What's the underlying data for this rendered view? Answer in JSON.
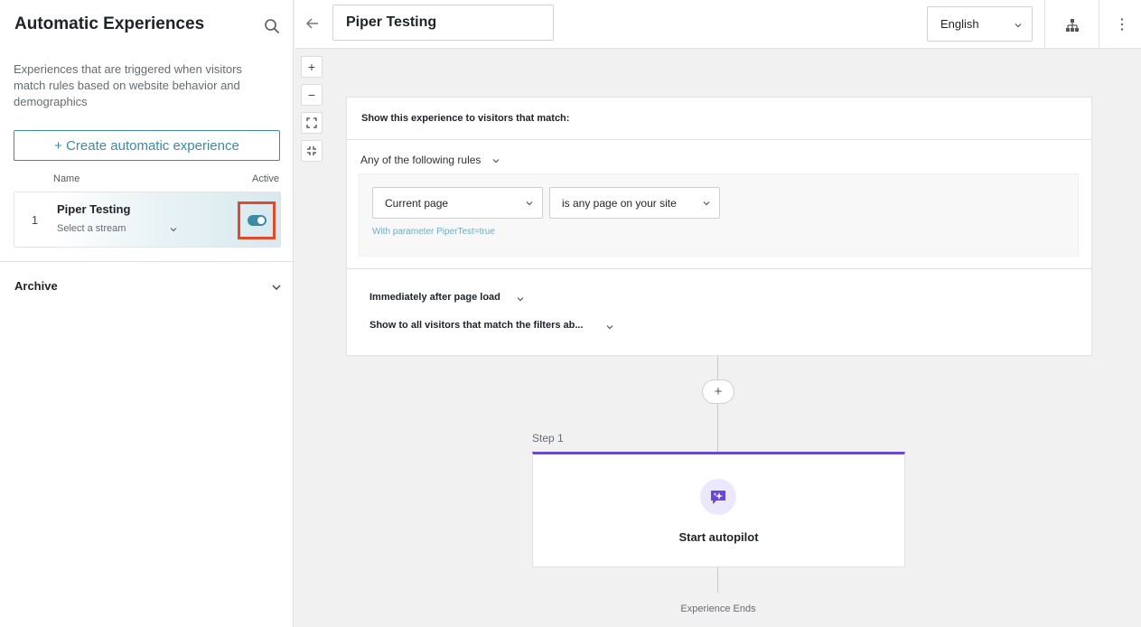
{
  "sidebar": {
    "title": "Automatic Experiences",
    "description": "Experiences that are triggered when visitors match rules based on website behavior and demographics",
    "create_button": "+ Create automatic experience",
    "columns": {
      "name": "Name",
      "active": "Active"
    },
    "rows": [
      {
        "index": "1",
        "name": "Piper Testing",
        "stream_placeholder": "Select a stream",
        "active": true
      }
    ],
    "archive_label": "Archive"
  },
  "header": {
    "title_value": "Piper Testing",
    "language": "English"
  },
  "zoom": {
    "in": "+",
    "out": "−"
  },
  "rule_card": {
    "heading": "Show this experience to visitors that match:",
    "match_mode": "Any of the following rules",
    "rule": {
      "field": "Current page",
      "operator": "is any page on your site",
      "parameter": "With parameter PiperTest=true"
    },
    "timing": "Immediately after page load",
    "audience": "Show to all visitors that match the filters ab..."
  },
  "flow": {
    "add_symbol": "+",
    "step_label": "Step 1",
    "step_title": "Start autopilot",
    "end_label": "Experience Ends"
  },
  "colors": {
    "accent": "#3d8aa3",
    "highlight": "#e04b2c",
    "step_accent": "#6b47d8"
  }
}
